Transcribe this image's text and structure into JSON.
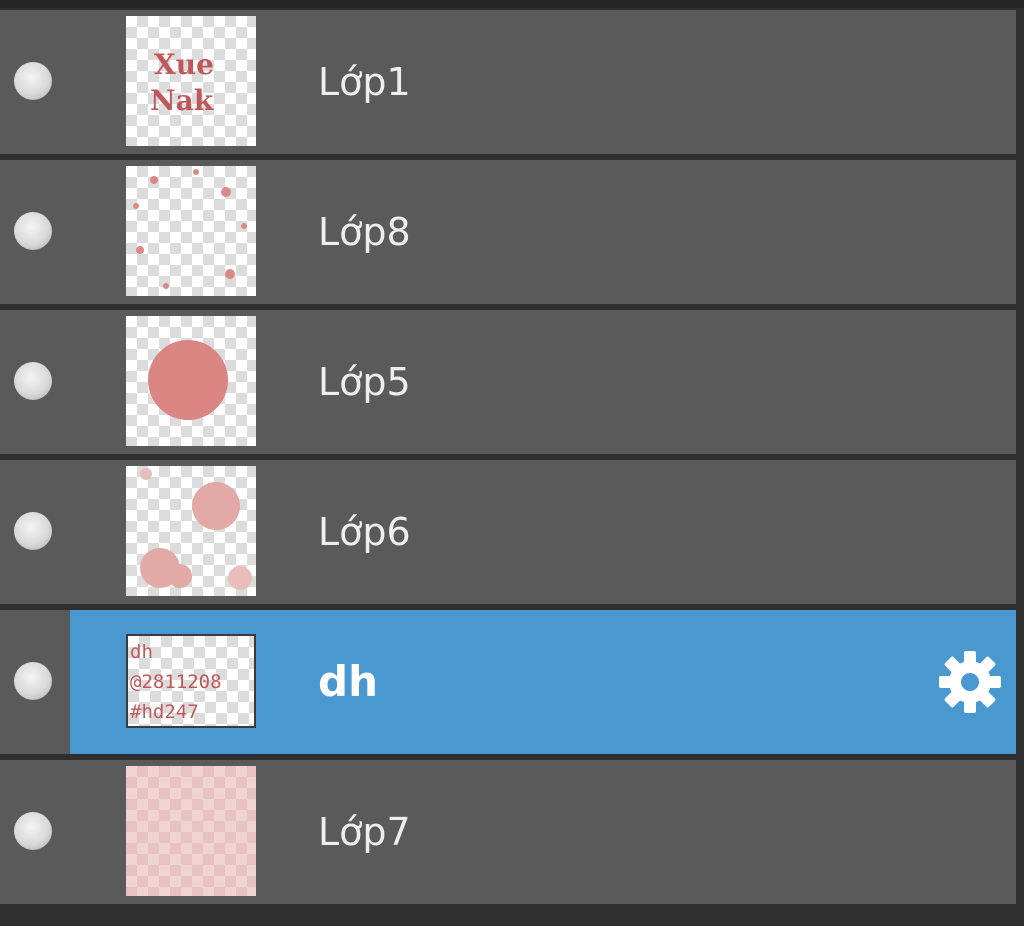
{
  "layers_panel": {
    "layers": [
      {
        "name": "Lớp1",
        "visible": true,
        "selected": false,
        "thumbnail": "text-art-thumbnail",
        "thumb_text": [
          "Xue",
          "Nak"
        ]
      },
      {
        "name": "Lớp8",
        "visible": true,
        "selected": false,
        "thumbnail": "scattered-dots-thumbnail"
      },
      {
        "name": "Lớp5",
        "visible": true,
        "selected": false,
        "thumbnail": "circle-thumbnail"
      },
      {
        "name": "Lớp6",
        "visible": true,
        "selected": false,
        "thumbnail": "blobs-thumbnail"
      },
      {
        "name": "dh",
        "visible": true,
        "selected": true,
        "thumbnail": "text-thumbnail",
        "thumb_text": [
          "dh",
          "@2811208",
          "#hd247"
        ],
        "settings_icon": "gear-icon"
      },
      {
        "name": "Lớp7",
        "visible": true,
        "selected": false,
        "thumbnail": "pink-fill-thumbnail"
      }
    ],
    "colors": {
      "row_background": "#5a5a5a",
      "selected_background": "#4a98d0",
      "panel_background": "#2f2f2f",
      "thumb_ink": "#c0585a",
      "thumb_soft": "#d98a88"
    }
  }
}
